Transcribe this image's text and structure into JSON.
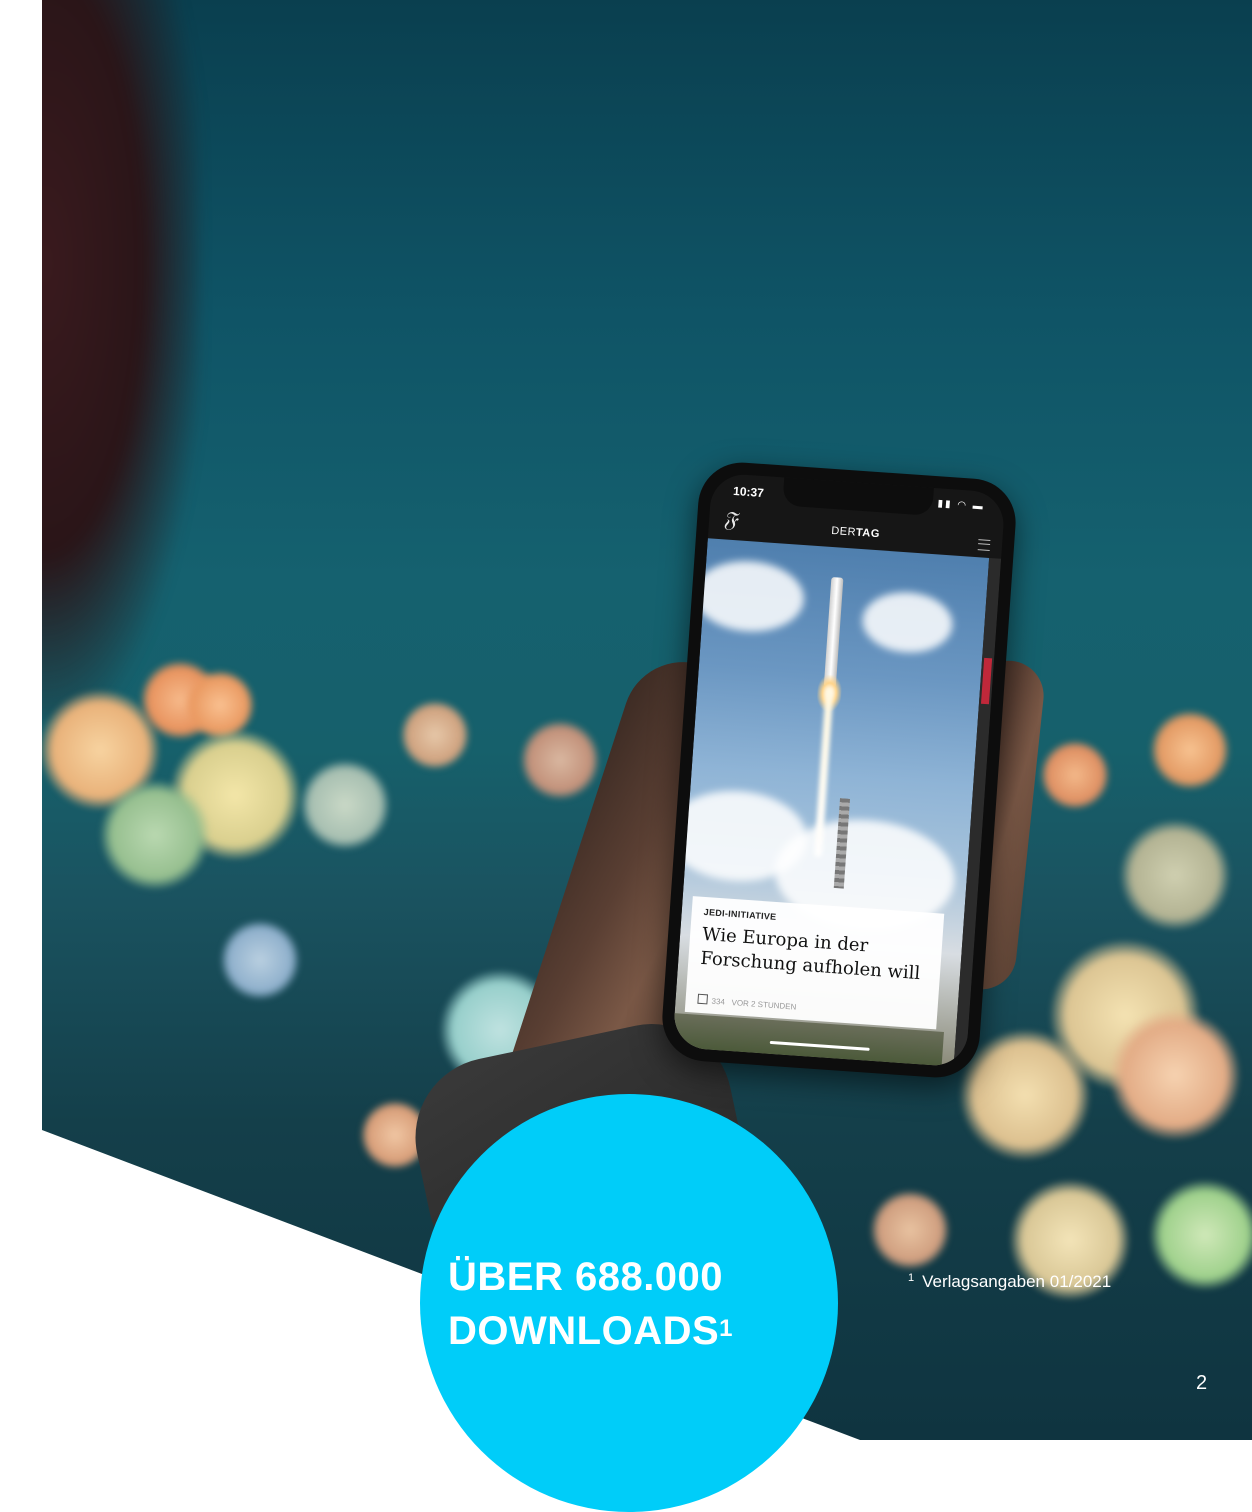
{
  "phone": {
    "status_time": "10:37",
    "app_logo": "𝔉",
    "app_title_prefix": "DER",
    "app_title_bold": "TAG",
    "article": {
      "kicker": "JEDI-INITIATIVE",
      "headline": "Wie Europa in der Forschung aufholen will",
      "share_count": "334",
      "timestamp": "VOR 2 STUNDEN"
    }
  },
  "badge": {
    "line1": "ÜBER 688.000",
    "line2": "DOWNLOADS",
    "superscript": "1"
  },
  "footnote": {
    "marker": "1",
    "text": "Verlagsangaben 01/2021"
  },
  "page_number": "2",
  "colors": {
    "badge": "#00cdf9",
    "text_on_badge": "#ffffff"
  }
}
